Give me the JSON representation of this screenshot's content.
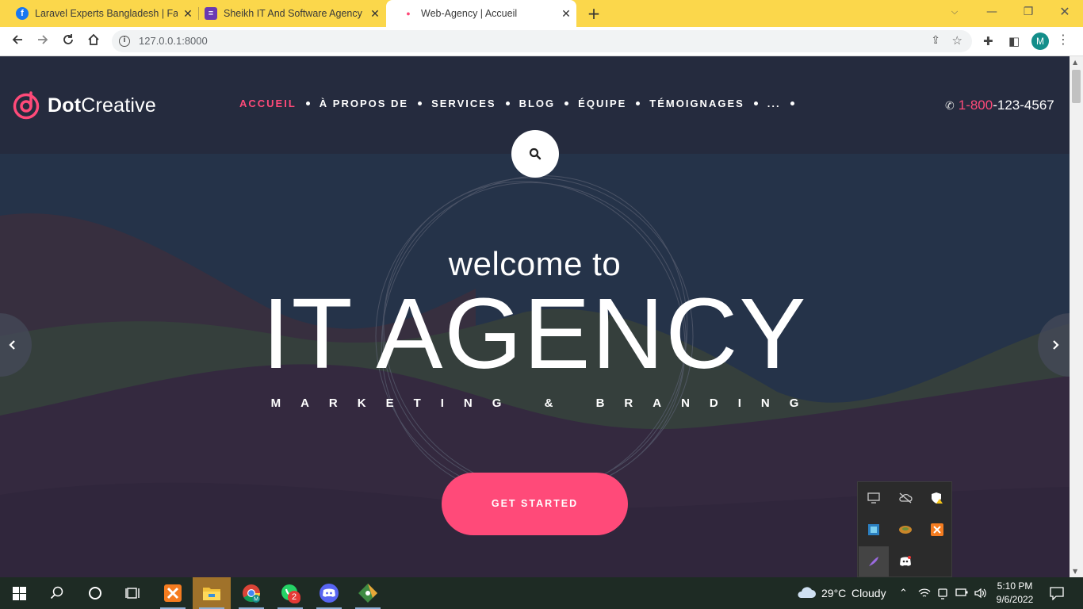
{
  "browser": {
    "tabs": [
      {
        "title": "Laravel Experts Bangladesh | Face",
        "favicon": "facebook-icon",
        "active": false
      },
      {
        "title": "Sheikh IT And Software Agency",
        "favicon": "list-icon",
        "active": false
      },
      {
        "title": "Web-Agency | Accueil",
        "favicon": "dot-icon",
        "active": true
      }
    ],
    "url": "127.0.0.1:8000",
    "profile_initial": "M"
  },
  "site": {
    "brand_bold": "Dot",
    "brand_light": "Creative",
    "nav": [
      "ACCUEIL",
      "À PROPOS DE",
      "SERVICES",
      "BLOG",
      "ÉQUIPE",
      "TÉMOIGNAGES",
      "..."
    ],
    "phone_prefix": "1-800",
    "phone_rest": "-123-4567",
    "hero": {
      "small": "welcome to",
      "big": "IT AGENCY",
      "sub": "MARKETING & BRANDING",
      "cta": "GET STARTED"
    },
    "accent_color": "#ff4a79"
  },
  "taskbar": {
    "weather_temp": "29°C",
    "weather_text": "Cloudy",
    "time": "5:10 PM",
    "date": "9/6/2022",
    "whatsapp_badge": "2"
  }
}
